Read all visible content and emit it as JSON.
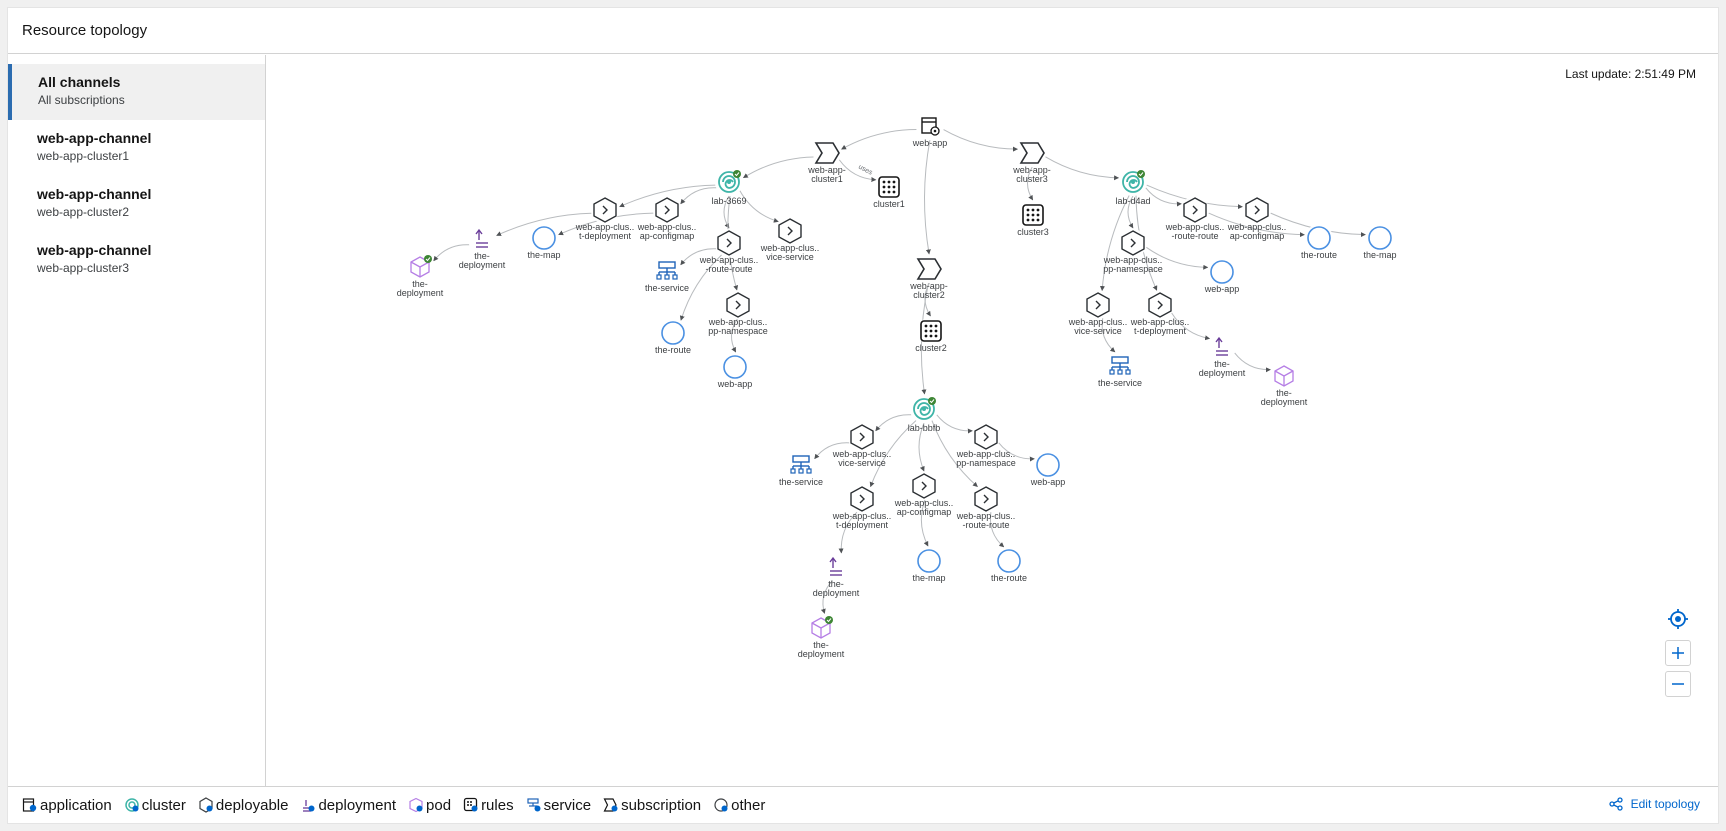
{
  "header": {
    "title": "Resource topology"
  },
  "sidebar": {
    "channels": [
      {
        "name": "All channels",
        "sub": "All subscriptions"
      },
      {
        "name": "web-app-channel",
        "sub": "web-app-cluster1"
      },
      {
        "name": "web-app-channel",
        "sub": "web-app-cluster2"
      },
      {
        "name": "web-app-channel",
        "sub": "web-app-cluster3"
      }
    ]
  },
  "canvas": {
    "last_update": "Last update: 2:51:49 PM",
    "edge_label_uses": "uses"
  },
  "legend": {
    "items": [
      {
        "label": "application",
        "icon": "application-icon"
      },
      {
        "label": "cluster",
        "icon": "cluster-icon"
      },
      {
        "label": "deployable",
        "icon": "deployable-icon"
      },
      {
        "label": "deployment",
        "icon": "deployment-icon"
      },
      {
        "label": "pod",
        "icon": "pod-icon"
      },
      {
        "label": "rules",
        "icon": "rules-icon"
      },
      {
        "label": "service",
        "icon": "service-icon"
      },
      {
        "label": "subscription",
        "icon": "subscription-icon"
      },
      {
        "label": "other",
        "icon": "other-icon"
      }
    ],
    "edit_label": "Edit topology"
  },
  "colors": {
    "accent": "#0066cc",
    "cluster": "#3fb5a8",
    "pod": "#b57ee5",
    "deployment": "#6a3d9a",
    "service": "#1f63b8",
    "status_ok": "#3e8635"
  },
  "nodes": {
    "app": {
      "label1": "web-app",
      "label2": ""
    },
    "sub1": {
      "label1": "web-app-",
      "label2": "cluster1"
    },
    "sub2": {
      "label1": "web-app-",
      "label2": "cluster2"
    },
    "sub3": {
      "label1": "web-app-",
      "label2": "cluster3"
    },
    "rules1": {
      "label1": "cluster1",
      "label2": ""
    },
    "rules2": {
      "label1": "cluster2",
      "label2": ""
    },
    "rules3": {
      "label1": "cluster3",
      "label2": ""
    },
    "c1": {
      "label1": "lab-3669",
      "label2": ""
    },
    "c1d1": {
      "label1": "web-app-clus..",
      "label2": "t-deployment"
    },
    "c1d2": {
      "label1": "web-app-clus..",
      "label2": "ap-configmap"
    },
    "c1d3": {
      "label1": "web-app-clus..",
      "label2": "-route-route"
    },
    "c1d4": {
      "label1": "web-app-clus..",
      "label2": "vice-service"
    },
    "c1d5": {
      "label1": "web-app-clus..",
      "label2": "pp-namespace"
    },
    "c1dep": {
      "label1": "the-",
      "label2": "deployment"
    },
    "c1pod": {
      "label1": "the-",
      "label2": "deployment"
    },
    "c1map": {
      "label1": "the-map",
      "label2": ""
    },
    "c1svc": {
      "label1": "the-service",
      "label2": ""
    },
    "c1route": {
      "label1": "the-route",
      "label2": ""
    },
    "c1web": {
      "label1": "web-app",
      "label2": ""
    },
    "c2": {
      "label1": "lab-bbfb",
      "label2": ""
    },
    "c2d1": {
      "label1": "web-app-clus..",
      "label2": "vice-service"
    },
    "c2d2": {
      "label1": "web-app-clus..",
      "label2": "pp-namespace"
    },
    "c2d3": {
      "label1": "web-app-clus..",
      "label2": "t-deployment"
    },
    "c2d4": {
      "label1": "web-app-clus..",
      "label2": "ap-configmap"
    },
    "c2d5": {
      "label1": "web-app-clus..",
      "label2": "-route-route"
    },
    "c2svc": {
      "label1": "the-service",
      "label2": ""
    },
    "c2web": {
      "label1": "web-app",
      "label2": ""
    },
    "c2dep": {
      "label1": "the-",
      "label2": "deployment"
    },
    "c2pod": {
      "label1": "the-",
      "label2": "deployment"
    },
    "c2map": {
      "label1": "the-map",
      "label2": ""
    },
    "c2route": {
      "label1": "the-route",
      "label2": ""
    },
    "c3": {
      "label1": "lab-d4ad",
      "label2": ""
    },
    "c3d1": {
      "label1": "web-app-clus..",
      "label2": "-route-route"
    },
    "c3d2": {
      "label1": "web-app-clus..",
      "label2": "ap-configmap"
    },
    "c3d3": {
      "label1": "web-app-clus..",
      "label2": "pp-namespace"
    },
    "c3d4": {
      "label1": "web-app-clus..",
      "label2": "vice-service"
    },
    "c3d5": {
      "label1": "web-app-clus..",
      "label2": "t-deployment"
    },
    "c3route": {
      "label1": "the-route",
      "label2": ""
    },
    "c3map": {
      "label1": "the-map",
      "label2": ""
    },
    "c3web": {
      "label1": "web-app",
      "label2": ""
    },
    "c3svc": {
      "label1": "the-service",
      "label2": ""
    },
    "c3dep": {
      "label1": "the-",
      "label2": "deployment"
    },
    "c3pod": {
      "label1": "the-",
      "label2": "deployment"
    }
  }
}
